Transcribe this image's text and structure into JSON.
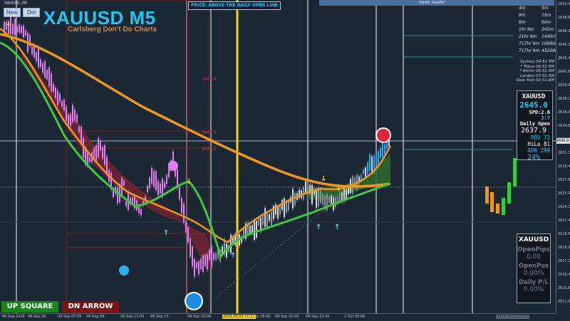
{
  "window": {
    "title": "XAUUSD,M5"
  },
  "toolbar": {
    "new_label": "New",
    "del_label": "Del"
  },
  "header": {
    "symbol_title": "XAUUSD M5",
    "subtitle": "Carlsberg Don't Do Charts"
  },
  "price_banner": "PRICE: ABOVE THE DAILY OPEN LINE",
  "news_reader": "news reader",
  "timeframes": [
    {
      "left": "4m",
      "right": "5m"
    },
    {
      "left": "9m",
      "right": "15m"
    },
    {
      "left": "9m",
      "right": "60m"
    },
    {
      "left": "1hr 9m",
      "right": "245m"
    },
    {
      "left": "21hr 9m",
      "right": "1440m"
    },
    {
      "left": "717hr 9m",
      "right": "10080m"
    },
    {
      "left": "717hr 9m",
      "right": "43200m"
    }
  ],
  "sessions": [
    "Sydney 04:51 PM",
    "* Tokyo 02:51 PM",
    "* Berlin 08:51 AM",
    "London 07:51 AM",
    "New York 02:51 AM"
  ],
  "info_panel": {
    "symbol": "XAUUSD",
    "price": "2645.0",
    "spd": "SPD:2.6",
    "ratio": "3:7",
    "daily_open_label": "Daily Open",
    "daily_open": "2637.9",
    "pdo": "PDO  72",
    "hilo": "HiLo  81",
    "adr": "ADR 299",
    "pct": "24%"
  },
  "account_panel": {
    "symbol": "XAUUSD",
    "open_pips_label": "OpenPips",
    "open_pips": "0.00",
    "open_pos_label": "OpenPos",
    "open_pos": "0.00%",
    "daily_pl_label": "Daily P/L",
    "daily_pl": "0.00%"
  },
  "buttons": {
    "up_square": "UP SQUARE",
    "dn_arrow": "DN ARROW"
  },
  "price_axis": [
    "2650.40",
    "2648.65",
    "2646.90",
    "2645.15",
    "2643.40",
    "2641.65",
    "2639.90",
    "2638.15",
    "2636.40",
    "2634.65",
    "2632.90",
    "2631.15",
    "2629.40",
    "2627.65",
    "2625.90",
    "2624.15",
    "2622.40",
    "2620.65",
    "2618.90",
    "2617.15",
    "2615.40",
    "2613.65",
    "2611.90"
  ],
  "time_axis": [
    "09 Sep 2024",
    "09 Sep 06:",
    "09 Sep 07:05",
    "09 Sep 09:",
    "09 Sep 11:05",
    "09 Sep 13:",
    "09 Sep 15:05",
    "2024.09.09 16:33",
    "09 Sep 18:45",
    "09 Sep 20:05",
    "09 Sep 22:45",
    "1 Oct 00:05",
    "2024.10.10 15:00"
  ],
  "levels": [
    "2648.8",
    "2645.3",
    "2640.1"
  ],
  "colors": {
    "bg": "#1c2734",
    "cyan": "#21c7f0",
    "orange": "#f0961e",
    "green": "#3ec83e",
    "magenta": "#e27ff0",
    "gold": "#f5d020"
  },
  "chart_data": {
    "type": "candlestick",
    "symbol": "XAUUSD",
    "timeframe": "M5",
    "current_price": 2645.0,
    "daily_open": 2637.9,
    "y_axis_range": [
      2611.9,
      2650.4
    ]
  }
}
